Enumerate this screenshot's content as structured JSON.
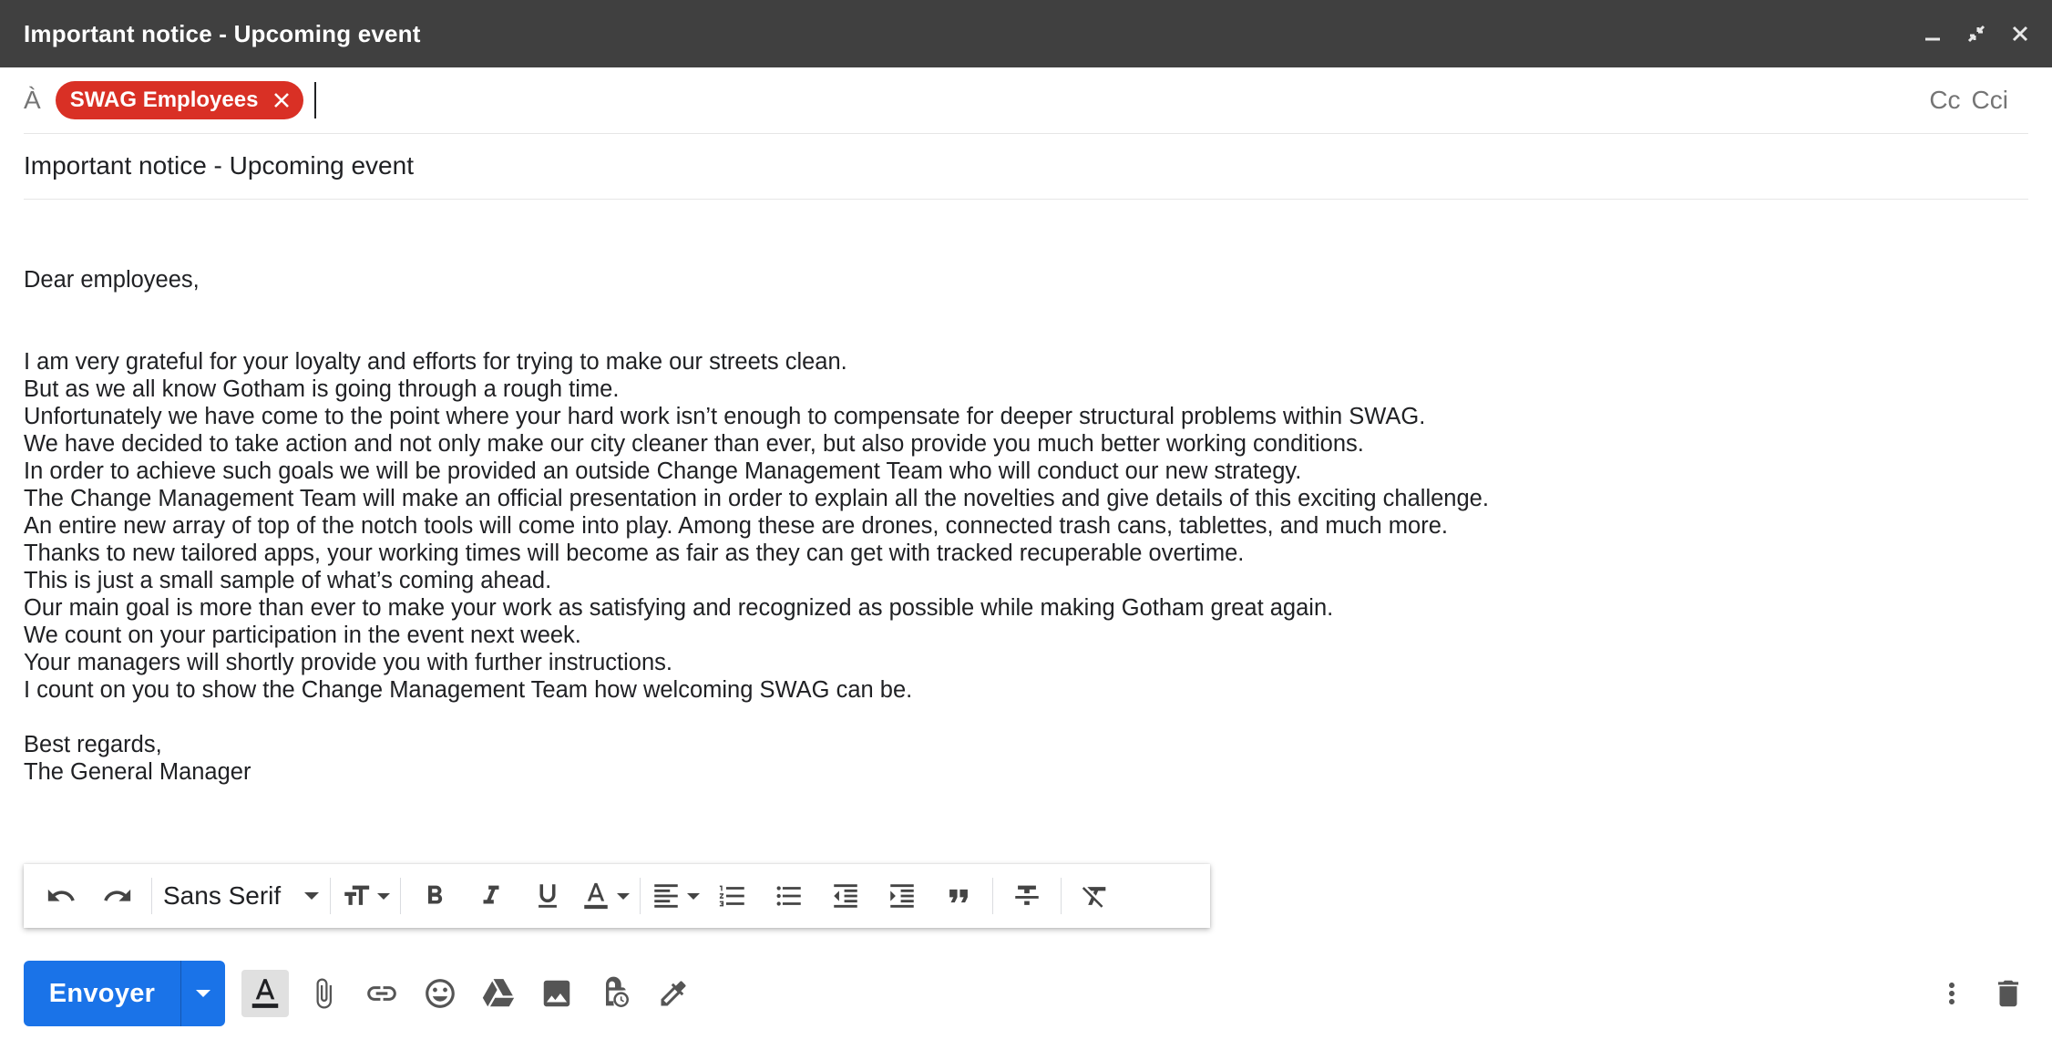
{
  "window": {
    "title": "Important notice - Upcoming event"
  },
  "recipients": {
    "to_label": "À",
    "chips": [
      {
        "label": "SWAG Employees",
        "color": "#d93025"
      }
    ],
    "cc_label": "Cc",
    "bcc_label": "Cci"
  },
  "subject": {
    "value": "Important notice - Upcoming event"
  },
  "body": {
    "lines": [
      "Dear employees,",
      "",
      "",
      "I am very grateful for your loyalty and efforts for trying to make our streets clean.",
      "But as we all know Gotham is going through a rough time.",
      "Unfortunately we have come to the point where your hard work isn’t enough to compensate for deeper structural problems within SWAG.",
      "We have decided to take action and not only make our city cleaner than ever, but also provide you much better working conditions.",
      "In order to achieve such goals we will be provided an outside Change Management Team who will conduct our new strategy.",
      "The Change Management Team will make an official presentation in order to explain all the novelties and give details of this exciting challenge.",
      "An entire new array of top of the notch tools will come into play. Among these are drones, connected trash cans, tablettes, and much more.",
      "Thanks to new tailored apps, your working times will become as fair as they can get with tracked recuperable overtime.",
      "This is just a small sample of what’s coming ahead.",
      "Our main goal is more than ever to make your work as satisfying and recognized as possible while making Gotham great again.",
      "We count on your participation in the event next week.",
      "Your managers will shortly provide you with further instructions.",
      "I count on you to show the Change Management Team how welcoming SWAG can be.",
      "",
      "Best regards,",
      "The General Manager"
    ]
  },
  "formatting": {
    "font_family_label": "Sans Serif",
    "icons": [
      "undo-icon",
      "redo-icon",
      "text-size-icon",
      "bold-icon",
      "italic-icon",
      "underline-icon",
      "text-color-icon",
      "align-icon",
      "numbered-list-icon",
      "bulleted-list-icon",
      "indent-less-icon",
      "indent-more-icon",
      "quote-icon",
      "strikethrough-icon",
      "remove-formatting-icon"
    ]
  },
  "actions": {
    "send_label": "Envoyer",
    "accent_color": "#1a73e8",
    "icons": [
      "formatting-toggle-icon",
      "attach-icon",
      "link-icon",
      "emoji-icon",
      "drive-icon",
      "photo-icon",
      "confidential-mode-icon",
      "signature-icon",
      "more-options-icon",
      "discard-icon"
    ]
  }
}
